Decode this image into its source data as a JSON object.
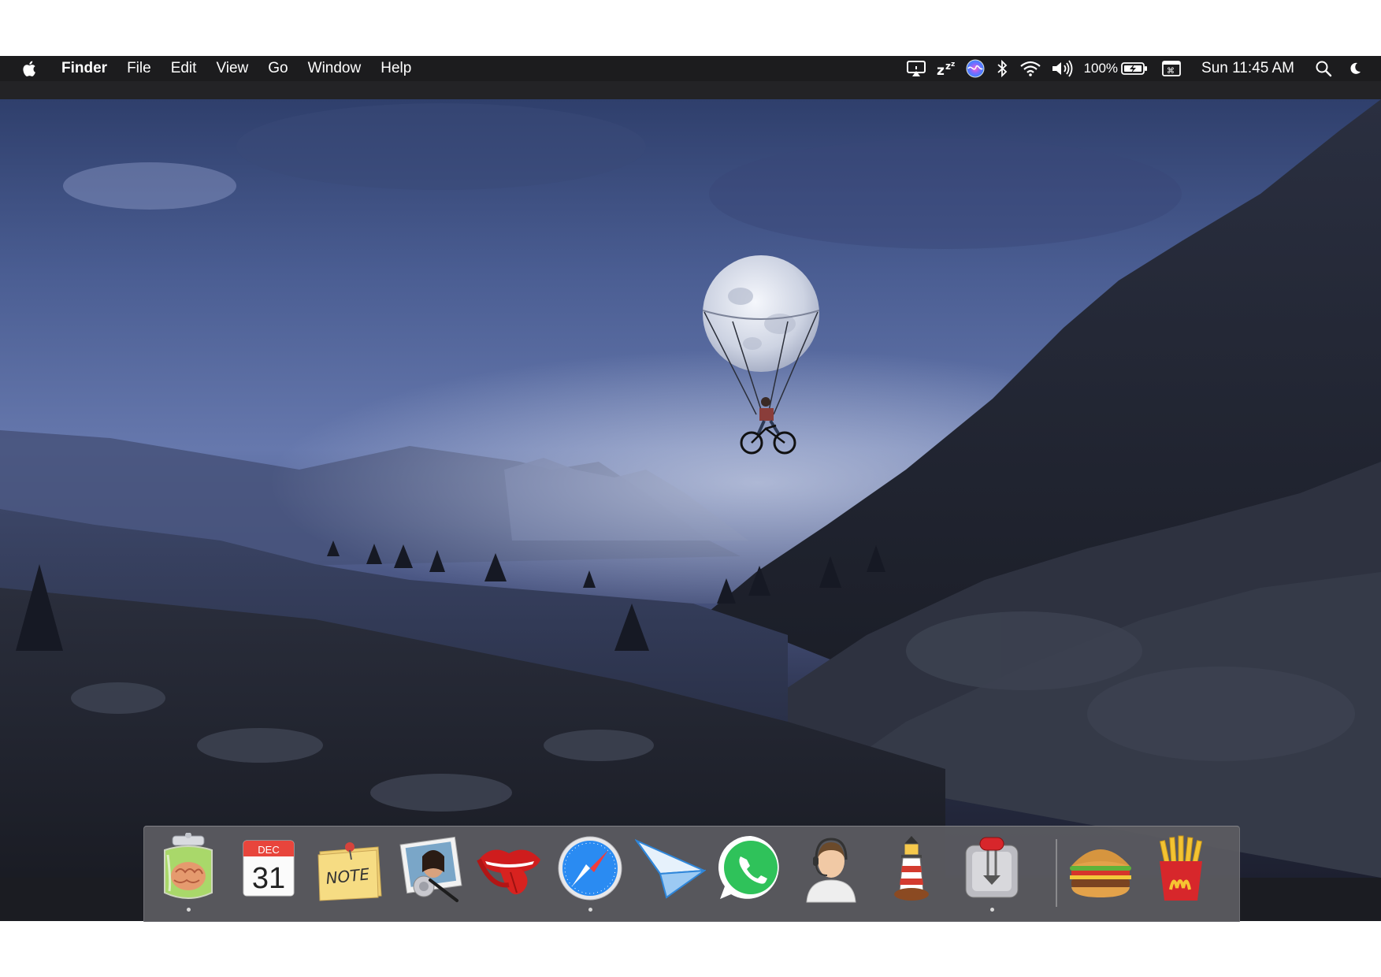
{
  "menubar": {
    "apple_icon": "apple-logo",
    "app_name": "Finder",
    "menus": [
      "File",
      "Edit",
      "View",
      "Go",
      "Window",
      "Help"
    ],
    "status": {
      "icons": [
        "airplay-icon",
        "sleep-zzz-icon",
        "siri-icon",
        "bluetooth-icon",
        "wifi-icon",
        "volume-icon"
      ],
      "battery_percent": "100%",
      "battery_icon": "battery-charging-icon",
      "keyboard_icon": "keyboard-viewer-icon",
      "clock": "Sun 11:45 AM",
      "search_icon": "spotlight-search-icon",
      "night_icon": "night-shift-moon-icon"
    }
  },
  "desktop": {
    "wallpaper": "misty mountain valley at night with moon balloon lifting a bicycle rider"
  },
  "dock": {
    "apps": [
      {
        "name": "brain-jar-app-icon",
        "running": true
      },
      {
        "name": "calendar-app-icon",
        "running": false,
        "month": "DEC",
        "day": "31"
      },
      {
        "name": "notes-app-icon",
        "running": false,
        "label": "NOTE"
      },
      {
        "name": "photo-booth-app-icon",
        "running": false
      },
      {
        "name": "rolling-stones-lips-icon",
        "running": false
      },
      {
        "name": "safari-app-icon",
        "running": true
      },
      {
        "name": "paper-plane-app-icon",
        "running": false
      },
      {
        "name": "whatsapp-app-icon",
        "running": false
      },
      {
        "name": "support-agent-app-icon",
        "running": false
      },
      {
        "name": "lighthouse-app-icon",
        "running": false
      },
      {
        "name": "transmission-app-icon",
        "running": true
      }
    ],
    "docs": [
      {
        "name": "burger-app-icon",
        "running": false
      },
      {
        "name": "fries-app-icon",
        "running": false
      }
    ]
  }
}
